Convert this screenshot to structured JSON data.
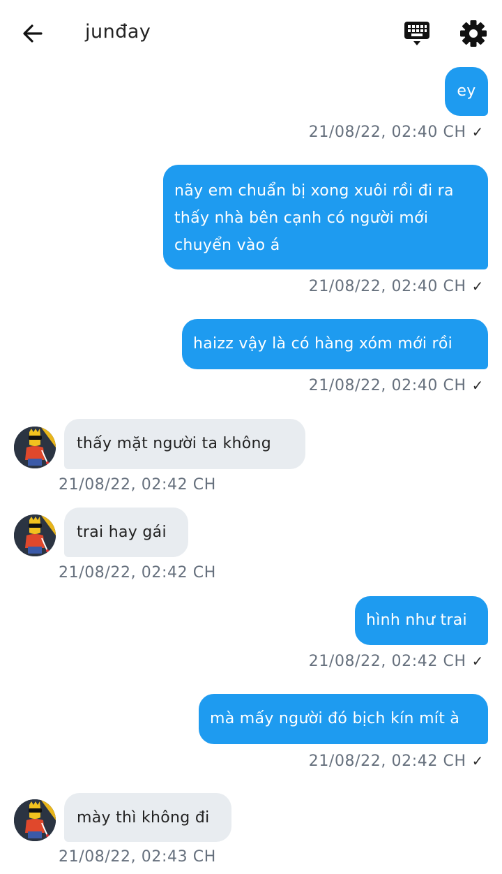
{
  "header": {
    "title": "junđay",
    "back_icon": "arrow-left-icon",
    "keyboard_icon": "keyboard-icon",
    "settings_icon": "gear-icon"
  },
  "colors": {
    "outgoing_bubble": "#1e9bf0",
    "incoming_bubble": "#e8ecf0",
    "timestamp": "#66707d"
  },
  "messages": [
    {
      "direction": "out",
      "text": "ey",
      "time": "21/08/22,  02:40 CH",
      "status": "✓"
    },
    {
      "direction": "out",
      "text": "nãy em chuẩn bị xong xuôi rồi đi ra thấy nhà bên cạnh có người mới chuyển vào á",
      "time": "21/08/22,  02:40 CH",
      "status": "✓"
    },
    {
      "direction": "out",
      "text": "haizz vậy là có hàng xóm mới rồi",
      "time": "21/08/22,  02:40 CH",
      "status": "✓"
    },
    {
      "direction": "in",
      "text": "thấy mặt người ta không",
      "time": "21/08/22,  02:42 CH"
    },
    {
      "direction": "in",
      "text": "trai hay gái",
      "time": "21/08/22,  02:42 CH"
    },
    {
      "direction": "out",
      "text": "hình như trai",
      "time": "21/08/22,  02:42 CH",
      "status": "✓"
    },
    {
      "direction": "out",
      "text": "mà mấy người đó bịch kín mít à",
      "time": "21/08/22,  02:42 CH",
      "status": "✓"
    },
    {
      "direction": "in",
      "text": "mày thì không đi",
      "time": "21/08/22,  02:43 CH"
    }
  ]
}
